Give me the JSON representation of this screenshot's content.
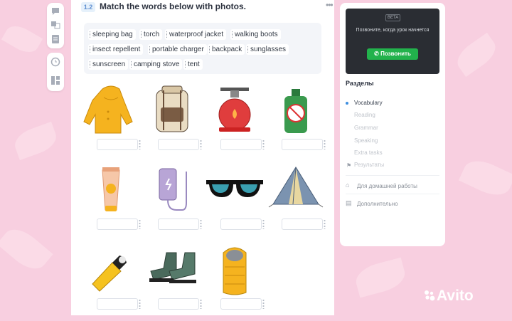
{
  "task": {
    "number": "1.2",
    "title": "Match the words below with photos."
  },
  "word_bank": [
    "sleeping bag",
    "torch",
    "waterproof jacket",
    "walking boots",
    "insect repellent",
    "portable charger",
    "backpack",
    "sunglasses",
    "sunscreen",
    "camping stove",
    "tent"
  ],
  "photos": [
    {
      "icon": "raincoat-icon"
    },
    {
      "icon": "backpack-icon"
    },
    {
      "icon": "camping-stove-icon"
    },
    {
      "icon": "insect-repellent-icon"
    },
    {
      "icon": "sunscreen-icon"
    },
    {
      "icon": "portable-charger-icon"
    },
    {
      "icon": "sunglasses-icon"
    },
    {
      "icon": "tent-icon"
    },
    {
      "icon": "torch-icon"
    },
    {
      "icon": "walking-boots-icon"
    },
    {
      "icon": "sleeping-bag-icon"
    }
  ],
  "video": {
    "badge": "BETA",
    "text": "Позвоните, когда урок начнется",
    "call_label": "Позвонить"
  },
  "sections": {
    "title": "Разделы",
    "items": [
      {
        "label": "Vocabulary",
        "active": true
      },
      {
        "label": "Reading"
      },
      {
        "label": "Grammar"
      },
      {
        "label": "Speaking"
      },
      {
        "label": "Extra tasks"
      },
      {
        "label": "Результаты"
      }
    ],
    "homework": "Для домашней работы",
    "extra": "Дополнительно"
  },
  "watermark": "Avito",
  "colors": {
    "accent_green": "#22b24c",
    "active_dot": "#3e8fe0",
    "background": "#f8cfe0"
  }
}
